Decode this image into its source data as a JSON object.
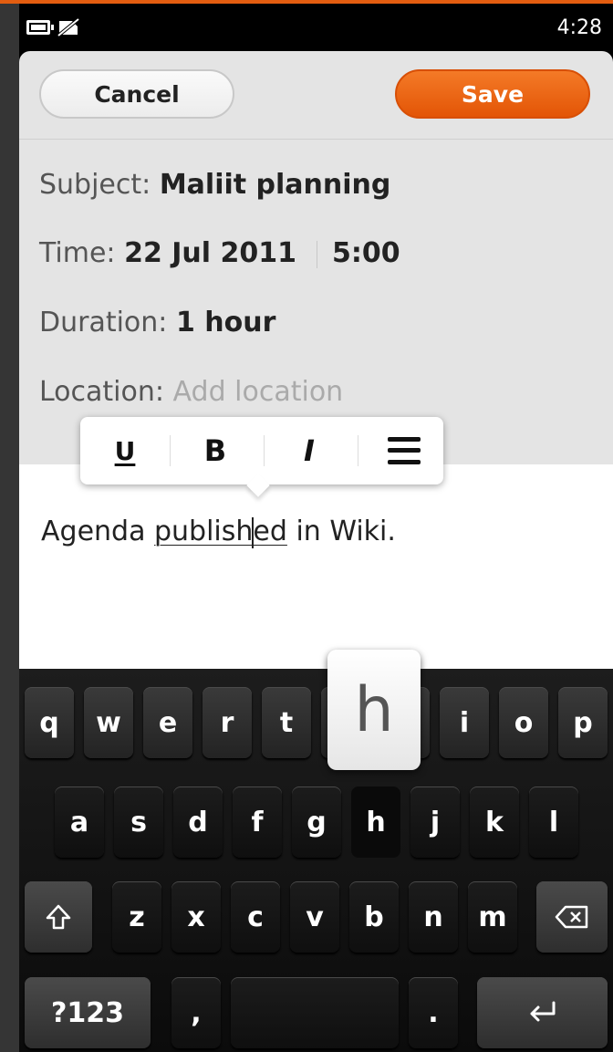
{
  "status_bar": {
    "time": "4:28",
    "icons": [
      "battery-icon",
      "no-sim-icon"
    ]
  },
  "header": {
    "cancel_label": "Cancel",
    "save_label": "Save"
  },
  "colors": {
    "accent": "#e35506",
    "background": "#e4e4e4",
    "keyboard": "#141414"
  },
  "form": {
    "subject": {
      "label": "Subject:",
      "value": "Maliit planning"
    },
    "time": {
      "label": "Time:",
      "date": "22 Jul 2011",
      "clock": "5:00"
    },
    "duration": {
      "label": "Duration:",
      "value": "1 hour"
    },
    "location": {
      "label": "Location:",
      "placeholder": "Add location"
    }
  },
  "format_toolbar": {
    "underline": "U",
    "bold": "B",
    "italic": "I",
    "align_icon": "align-justify-icon"
  },
  "note": {
    "before": "Agenda ",
    "selected_before_caret": "publish",
    "selected_after_caret": "ed",
    "after": " in Wiki."
  },
  "keyboard": {
    "row1": [
      "q",
      "w",
      "e",
      "r",
      "t",
      "y",
      "u",
      "i",
      "o",
      "p"
    ],
    "row2": [
      "a",
      "s",
      "d",
      "f",
      "g",
      "h",
      "j",
      "k",
      "l"
    ],
    "row3": [
      "z",
      "x",
      "c",
      "v",
      "b",
      "n",
      "m"
    ],
    "symbols_label": "?123",
    "comma": ",",
    "period": ".",
    "magnified_key": "h",
    "shift_icon": "shift-icon",
    "backspace_icon": "backspace-icon",
    "enter_icon": "enter-icon"
  }
}
